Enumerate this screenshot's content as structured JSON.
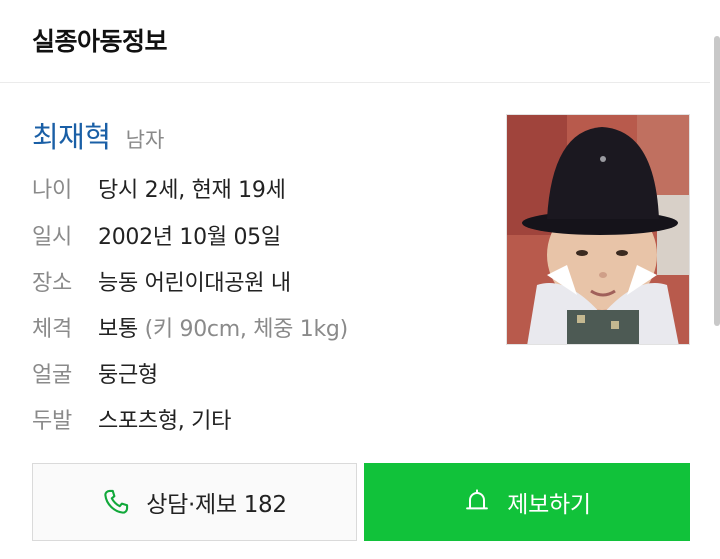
{
  "header": {
    "title": "실종아동정보"
  },
  "person": {
    "name": "최재혁",
    "gender": "남자"
  },
  "details": [
    {
      "label": "나이",
      "value": "당시 2세, 현재 19세",
      "extra": ""
    },
    {
      "label": "일시",
      "value": "2002년 10월 05일",
      "extra": ""
    },
    {
      "label": "장소",
      "value": "능동 어린이대공원 내",
      "extra": ""
    },
    {
      "label": "체격",
      "value": "보통",
      "extra": " (키 90cm, 체중 1kg)"
    },
    {
      "label": "얼굴",
      "value": "둥근형",
      "extra": ""
    },
    {
      "label": "두발",
      "value": "스포츠형, 기타",
      "extra": ""
    }
  ],
  "actions": {
    "call_label": "상담·제보 182",
    "report_label": "제보하기",
    "call_icon": "phone-icon",
    "report_icon": "bell-icon"
  },
  "colors": {
    "name": "#1a5fa6",
    "report_button": "#11c23a",
    "call_icon": "#11a83a",
    "label_gray": "#8a8a8a"
  }
}
